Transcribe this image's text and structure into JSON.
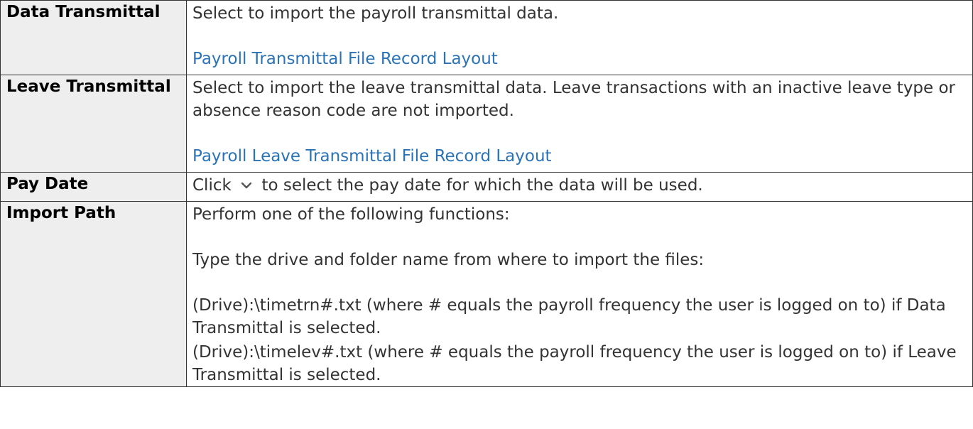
{
  "rows": {
    "data_transmittal": {
      "term": "Data Transmittal",
      "description": "Select to import the payroll transmittal data.",
      "link": "Payroll Transmittal File Record Layout"
    },
    "leave_transmittal": {
      "term": "Leave Transmittal",
      "description": "Select to import the leave transmittal data. Leave transactions with an inactive leave type or absence reason code are not imported.",
      "link": "Payroll Leave Transmittal File Record Layout"
    },
    "pay_date": {
      "term": "Pay Date",
      "prefix": "Click",
      "icon": "chevron-down-icon",
      "suffix": "to select the pay date for which the data will be used."
    },
    "import_path": {
      "term": "Import Path",
      "intro": "Perform one of the following functions:",
      "instruction": "Type the drive and folder name from where to import the files:",
      "path_data": "(Drive):\\timetrn#.txt (where # equals the payroll frequency the user is logged on to) if Data Transmittal is selected.",
      "path_leave": "(Drive):\\timelev#.txt (where # equals the payroll frequency the user is logged on to) if Leave Transmittal is selected."
    }
  },
  "colors": {
    "link": "#2b73b7",
    "term_background": "#eeeeee",
    "border": "#333333"
  }
}
